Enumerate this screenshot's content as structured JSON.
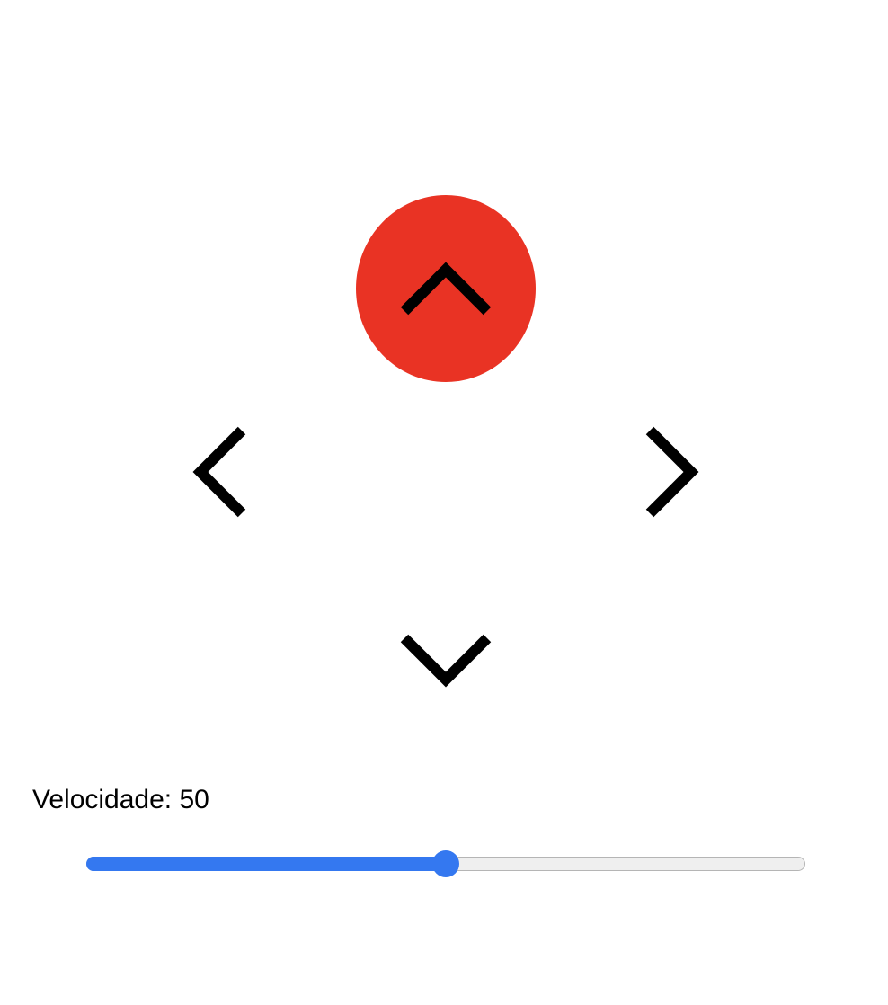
{
  "controls": {
    "active_direction": "up",
    "active_color": "#e93324",
    "buttons": [
      {
        "direction": "up",
        "icon": "chevron-up-icon"
      },
      {
        "direction": "left",
        "icon": "chevron-left-icon"
      },
      {
        "direction": "right",
        "icon": "chevron-right-icon"
      },
      {
        "direction": "down",
        "icon": "chevron-down-icon"
      }
    ]
  },
  "speed": {
    "label": "Velocidade: 50",
    "value": 50,
    "min": 0,
    "max": 100,
    "fill_color": "#3478f0",
    "track_color": "#efefef"
  }
}
